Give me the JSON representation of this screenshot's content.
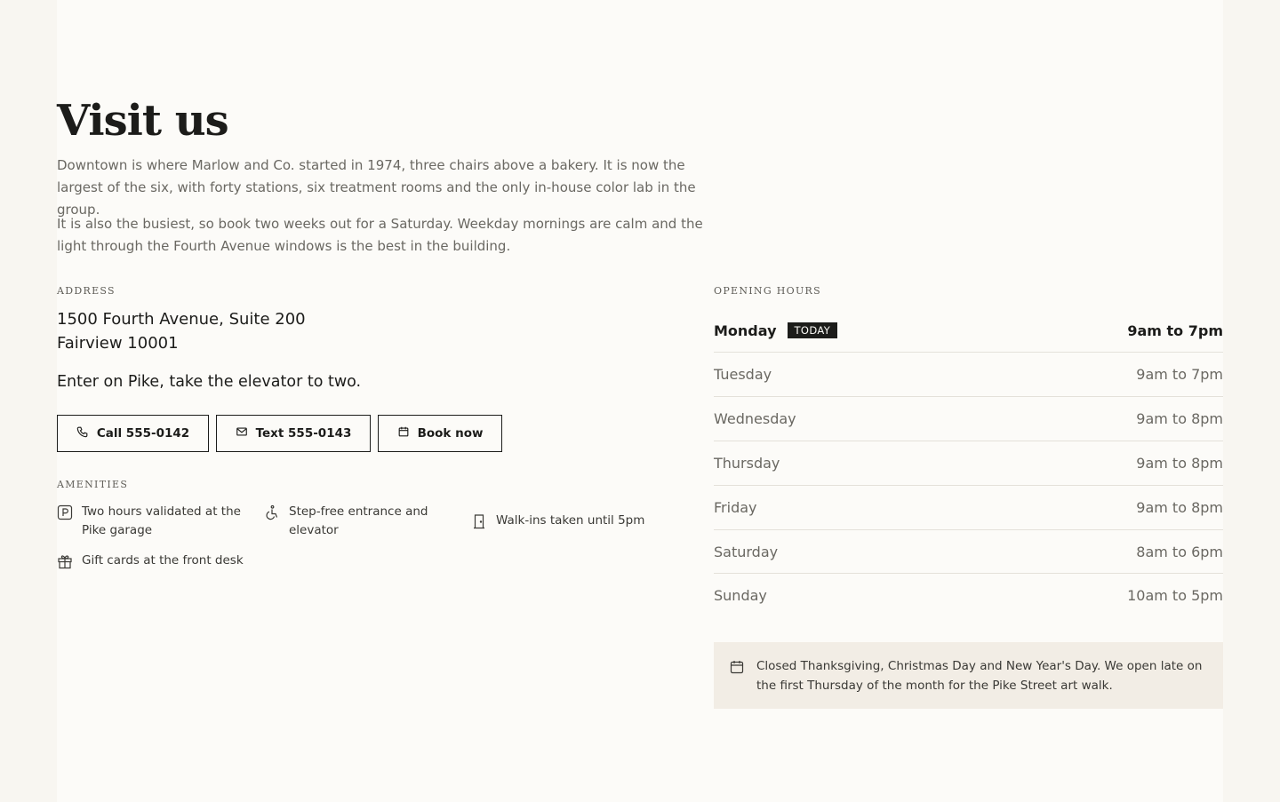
{
  "page": {
    "title": "Visit us",
    "intro": [
      "Downtown is where Marlow and Co. started in 1974, three chairs above a bakery. It is now the largest of the six, with forty stations, six treatment rooms and the only in-house color lab in the group.",
      "It is also the busiest, so book two weeks out for a Saturday. Weekday mornings are calm and the light through the Fourth Avenue windows is the best in the building."
    ]
  },
  "address": {
    "label": "Address",
    "line1": "1500 Fourth Avenue, Suite 200",
    "line2": "Fairview 10001",
    "directions": "Enter on Pike, take the elevator to two."
  },
  "actions": {
    "call": "Call 555-0142",
    "text": "Text 555-0143",
    "book": "Book now"
  },
  "amenities": {
    "label": "Amenities",
    "items": [
      {
        "icon": "parking-icon",
        "text": "Two hours validated at the Pike garage"
      },
      {
        "icon": "accessibility-icon",
        "text": "Step-free entrance and elevator"
      },
      {
        "icon": "door-icon",
        "text": "Walk-ins taken until 5pm"
      },
      {
        "icon": "gift-icon",
        "text": "Gift cards at the front desk"
      }
    ]
  },
  "hours": {
    "label": "Opening hours",
    "today_badge": "TODAY",
    "days": [
      {
        "day": "Monday",
        "time": "9am to 7pm",
        "today": true
      },
      {
        "day": "Tuesday",
        "time": "9am to 7pm"
      },
      {
        "day": "Wednesday",
        "time": "9am to 8pm"
      },
      {
        "day": "Thursday",
        "time": "9am to 8pm"
      },
      {
        "day": "Friday",
        "time": "9am to 8pm"
      },
      {
        "day": "Saturday",
        "time": "8am to 6pm"
      },
      {
        "day": "Sunday",
        "time": "10am to 5pm"
      }
    ],
    "notice": "Closed Thanksgiving, Christmas Day and New Year's Day. We open late on the first Thursday of the month for the Pike Street art walk."
  },
  "colors": {
    "background": "#f8f6f1",
    "panel": "#fcfbf8",
    "ink": "#1c1c1a",
    "muted": "#6a6862",
    "notice_bg": "#f2ede5"
  }
}
